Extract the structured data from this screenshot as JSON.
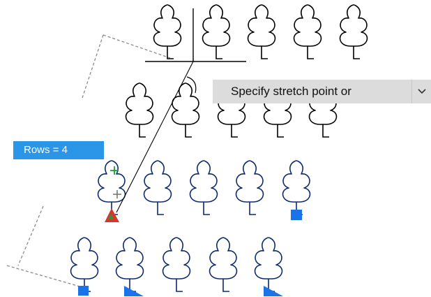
{
  "tooltip": {
    "rows_text": "Rows = 4"
  },
  "command_prompt": {
    "text": "Specify stretch point or",
    "dropdown_icon": "chevron-down-icon"
  },
  "colors": {
    "grip_blue": "#1a73e8",
    "tooltip_blue": "#2b95e8",
    "prompt_gray": "#dcdcdc",
    "grip_red": "#d9362b",
    "grip_green": "#1f9d3a"
  }
}
